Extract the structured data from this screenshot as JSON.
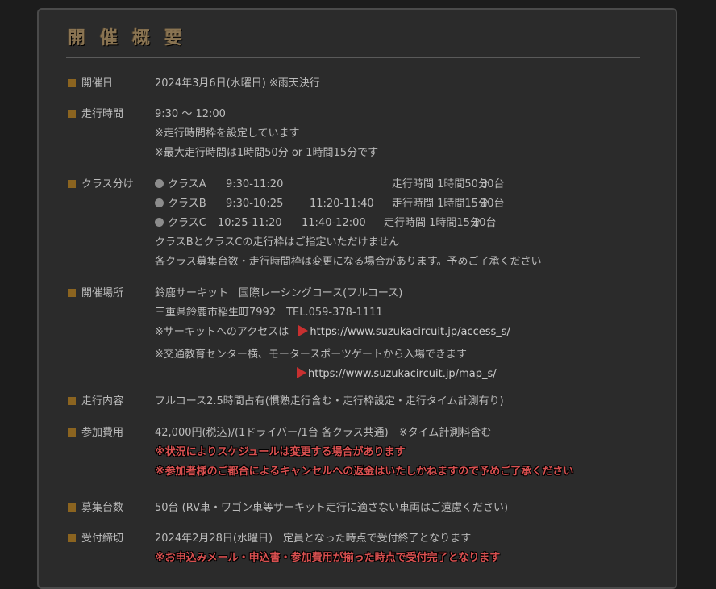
{
  "title": "開催概要",
  "sections": {
    "date": {
      "label": "開催日",
      "lines": [
        "2024年3月6日(水曜日) ※雨天決行"
      ]
    },
    "run_time": {
      "label": "走行時間",
      "lines": [
        "9:30 ～ 12:00",
        "※走行時間枠を設定しています",
        "※最大走行時間は1時間50分 or 1時間15分です"
      ]
    },
    "classes": {
      "label": "クラス分け",
      "items": [
        {
          "name": "クラスA",
          "time1": "9:30-11:20",
          "time2": "",
          "duration": "走行時間 1時間50分",
          "count": "30台"
        },
        {
          "name": "クラスB",
          "time1": "9:30-10:25",
          "time2": "11:20-11:40",
          "duration": "走行時間 1時間15分",
          "count": "10台"
        },
        {
          "name": "クラスC",
          "time1": "10:25-11:20",
          "time2": "11:40-12:00",
          "duration": "走行時間 1時間15分",
          "count": "10台"
        }
      ],
      "notes": [
        "クラスBとクラスCの走行枠はご指定いただけません",
        "各クラス募集台数・走行時間枠は変更になる場合があります。予めご了承ください"
      ]
    },
    "venue": {
      "label": "開催場所",
      "lines": [
        "鈴鹿サーキット　国際レーシングコース(フルコース)",
        "三重県鈴鹿市稲生町7992　TEL.059-378-1111"
      ],
      "access_prefix": "※サーキットへのアクセスは",
      "access_url": "https://www.suzukacircuit.jp/access_s/",
      "gate_note": "※交通教育センター横、モータースポーツゲートから入場できます",
      "map_url": "https://www.suzukacircuit.jp/map_s/"
    },
    "content": {
      "label": "走行内容",
      "lines": [
        "フルコース2.5時間占有(慣熟走行含む・走行枠設定・走行タイム計測有り)"
      ]
    },
    "fee": {
      "label": "参加費用",
      "lines": [
        "42,000円(税込)/(1ドライバー/1台 各クラス共通)　※タイム計測料含む"
      ],
      "red_lines": [
        "※状況によりスケジュールは変更する場合があります",
        "※参加者様のご都合によるキャンセルへの返金はいたしかねますので予めご了承ください"
      ]
    },
    "capacity": {
      "label": "募集台数",
      "lines": [
        "50台 (RV車・ワゴン車等サーキット走行に適さない車両はご遠慮ください)"
      ]
    },
    "deadline": {
      "label": "受付締切",
      "lines": [
        "2024年2月28日(水曜日)　定員となった時点で受付終了となります"
      ],
      "red_lines": [
        "※お申込みメール・申込書・参加費用が揃った時点で受付完了となります"
      ]
    }
  },
  "colors": {
    "accent_square": "#8b6420",
    "title": "#8a7452",
    "warning": "#d95050",
    "link_arrow": "#c83030"
  }
}
